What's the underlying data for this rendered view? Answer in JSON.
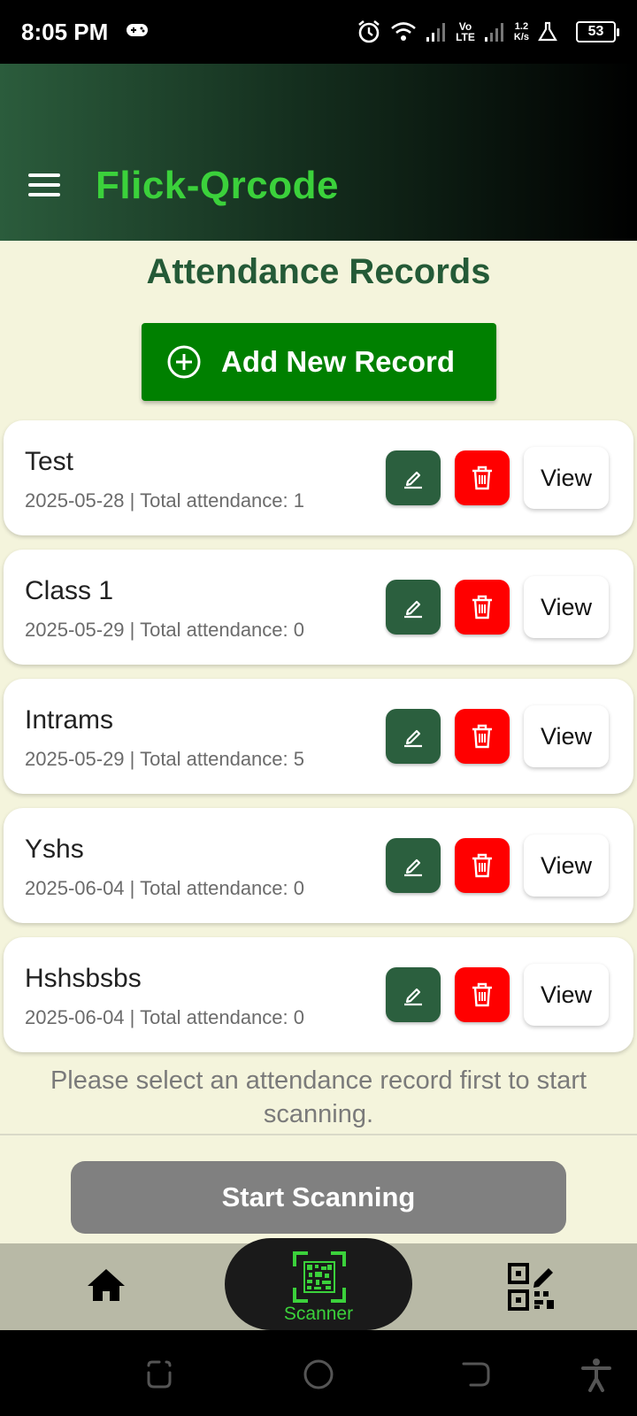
{
  "status_bar": {
    "time": "8:05 PM",
    "volte_top": "Vo",
    "volte_bottom": "LTE",
    "speed_top": "1.2",
    "speed_bottom": "K/s",
    "battery": "53",
    "icons": [
      "gamepad-icon",
      "alarm-icon",
      "wifi-icon",
      "signal-icon",
      "signal-icon",
      "flask-icon",
      "battery-icon"
    ]
  },
  "app_bar": {
    "title": "Flick-Qrcode",
    "menu_icon": "hamburger-icon"
  },
  "main": {
    "title": "Attendance Records",
    "add_button_label": "Add New Record",
    "records": [
      {
        "name": "Test",
        "date": "2025-05-28",
        "meta": "2025-05-28 | Total attendance: 1",
        "attendance": 1,
        "view_label": "View"
      },
      {
        "name": "Class 1",
        "date": "2025-05-29",
        "meta": "2025-05-29 | Total attendance: 0",
        "attendance": 0,
        "view_label": "View"
      },
      {
        "name": "Intrams",
        "date": "2025-05-29",
        "meta": "2025-05-29 | Total attendance: 5",
        "attendance": 5,
        "view_label": "View"
      },
      {
        "name": "Yshs",
        "date": "2025-06-04",
        "meta": "2025-06-04 | Total attendance: 0",
        "attendance": 0,
        "view_label": "View"
      },
      {
        "name": "Hshsbsbs",
        "date": "2025-06-04",
        "meta": "2025-06-04 | Total attendance: 0",
        "attendance": 0,
        "view_label": "View"
      }
    ],
    "hint": "Please select an attendance record first to start scanning.",
    "start_button_label": "Start Scanning"
  },
  "bottom_nav": {
    "items": [
      {
        "icon": "home-icon",
        "label": ""
      },
      {
        "icon": "scanner-icon",
        "label": "Scanner",
        "active": true
      },
      {
        "icon": "qr-edit-icon",
        "label": ""
      }
    ]
  },
  "colors": {
    "accent_green": "#3bd13b",
    "title_green": "#245a37",
    "add_button": "#008000",
    "edit_button": "#2b5f3e",
    "delete_button": "#ff0000",
    "start_button_disabled": "#808080",
    "background": "#f4f4dc"
  }
}
